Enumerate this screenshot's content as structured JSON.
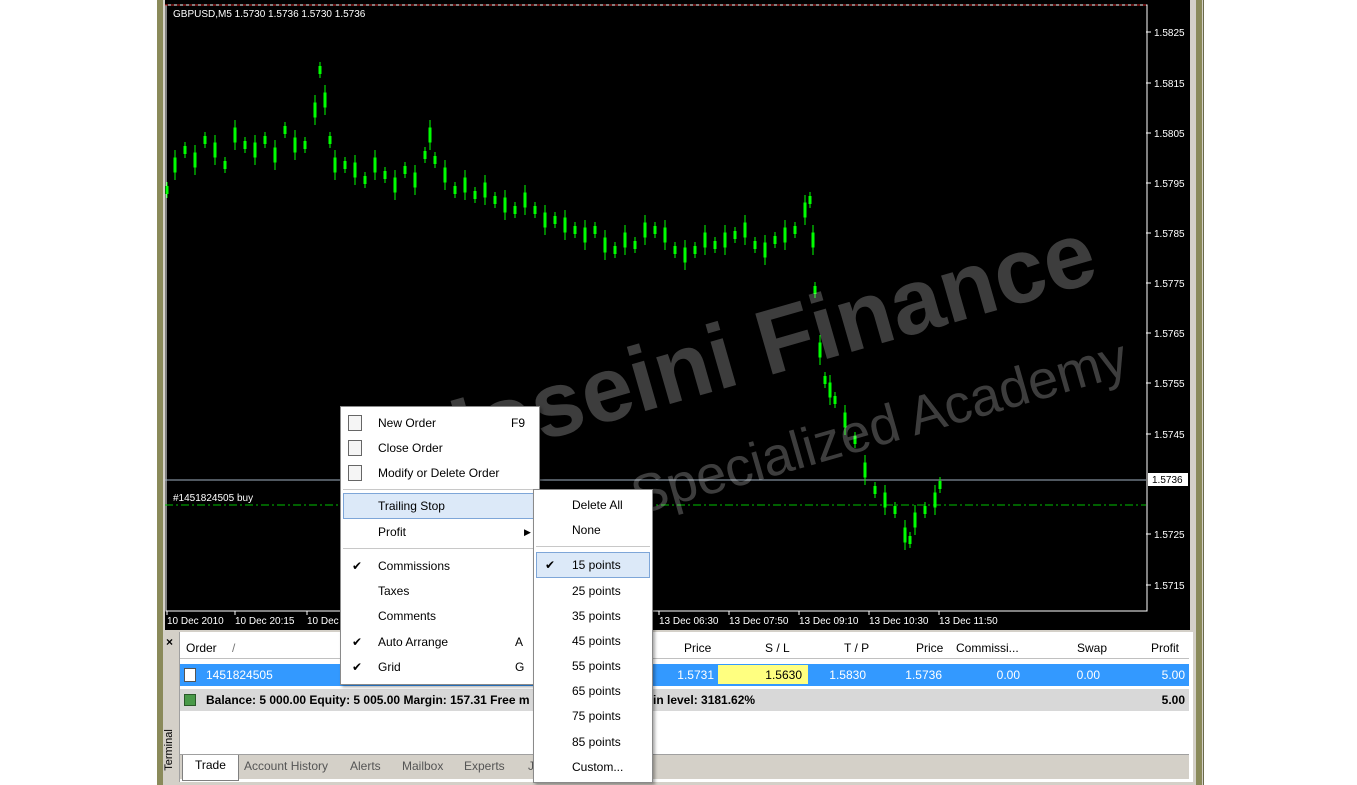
{
  "chart": {
    "symbol_info": "GBPUSD,M5  1.5730 1.5736 1.5730 1.5736",
    "order_line_label": "#1451824505 buy",
    "current_price": "1.5736",
    "price_axis": [
      "1.5825",
      "1.5815",
      "1.5805",
      "1.5795",
      "1.5785",
      "1.5775",
      "1.5765",
      "1.5755",
      "1.5745",
      "1.5725",
      "1.5715"
    ],
    "time_axis": [
      "10 Dec 2010",
      "10 Dec 20:15",
      "10 Dec",
      "13 Dec 06:30",
      "13 Dec 07:50",
      "13 Dec 09:10",
      "13 Dec 10:30",
      "13 Dec 11:50"
    ],
    "colors": {
      "background": "#000000",
      "candles": "#00ff00",
      "order_line": "#00c000",
      "current_line": "#a0b0c0"
    }
  },
  "watermark": {
    "line1": "Hoseini Finance",
    "line2": "Finance Specialized Academy"
  },
  "context_menu": {
    "items": [
      {
        "label": "New Order",
        "shortcut": "F9",
        "icon": "new-order-icon"
      },
      {
        "label": "Close Order",
        "shortcut": "",
        "icon": "close-order-icon"
      },
      {
        "label": "Modify or Delete Order",
        "shortcut": "",
        "icon": "modify-order-icon"
      },
      {
        "label": "Trailing Stop",
        "shortcut": "",
        "highlighted": true
      },
      {
        "label": "Profit",
        "shortcut": "",
        "submenu": true
      },
      {
        "label": "Commissions",
        "shortcut": "",
        "checked": true
      },
      {
        "label": "Taxes",
        "shortcut": ""
      },
      {
        "label": "Comments",
        "shortcut": ""
      },
      {
        "label": "Auto Arrange",
        "shortcut": "A",
        "checked": true
      },
      {
        "label": "Grid",
        "shortcut": "G",
        "checked": true
      }
    ]
  },
  "trailing_submenu": {
    "items": [
      "Delete All",
      "None",
      "15 points",
      "25 points",
      "35 points",
      "45 points",
      "55 points",
      "65 points",
      "75 points",
      "85 points",
      "Custom..."
    ],
    "selected": "15 points"
  },
  "terminal": {
    "side_label": "Terminal",
    "columns": [
      "Order",
      "/",
      "Price",
      "S / L",
      "T / P",
      "Price",
      "Commissi...",
      "Swap",
      "Profit"
    ],
    "row": {
      "order": "1451824505",
      "open_price": "1.5731",
      "sl": "1.5630",
      "tp": "1.5830",
      "price": "1.5736",
      "commission": "0.00",
      "swap": "0.00",
      "profit": "5.00"
    },
    "balance_left": "Balance: 5 000.00  Equity: 5 005.00  Margin: 157.31  Free m",
    "balance_right": "in level: 3181.62%",
    "balance_profit": "5.00",
    "tabs": [
      "Trade",
      "Account History",
      "Alerts",
      "Mailbox",
      "Experts",
      "J"
    ]
  }
}
